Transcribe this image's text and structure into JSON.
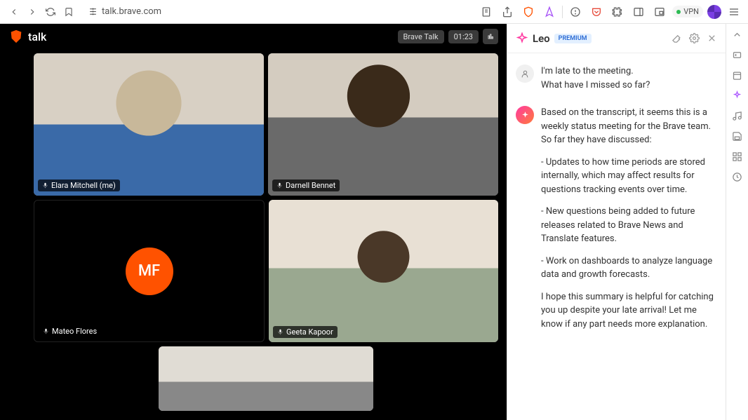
{
  "toolbar": {
    "url": "talk.brave.com",
    "vpn_label": "VPN"
  },
  "call": {
    "app_name": "talk",
    "call_name": "Brave Talk",
    "timer": "01:23",
    "participants": [
      {
        "name": "Elara Mitchell (me)"
      },
      {
        "name": "Darnell Bennet"
      },
      {
        "name": "Mateo Flores",
        "initials": "MF",
        "no_video": true
      },
      {
        "name": "Geeta Kapoor"
      }
    ]
  },
  "leo": {
    "title": "Leo",
    "badge": "PREMIUM",
    "messages": {
      "user_line1": "I'm late to the meeting.",
      "user_line2": "What have I missed so far?",
      "ai_intro": "Based on the transcript, it seems this is a weekly status meeting for the Brave team. So far they have discussed:",
      "ai_bullet1": "- Updates to how time periods are stored internally, which may affect results for questions tracking events over time.",
      "ai_bullet2": "- New questions being added to future releases related to Brave News and Translate features.",
      "ai_bullet3": "- Work on dashboards to analyze language data and growth forecasts.",
      "ai_closing": "I hope this summary is helpful for catching you up despite your late arrival! Let me know if any part needs more explanation."
    }
  },
  "colors": {
    "avatar_bg": "#ff5200",
    "leo_gradient_a": "#ff3aa1",
    "leo_gradient_b": "#ff7a3a"
  }
}
